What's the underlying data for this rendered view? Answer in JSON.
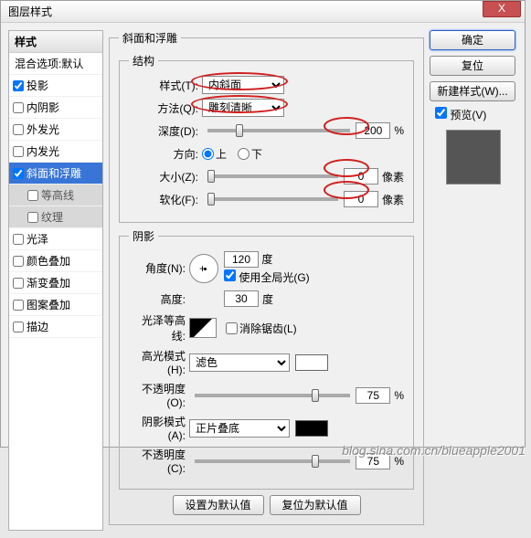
{
  "title": "图层样式",
  "close_x": "X",
  "sidebar": {
    "header": "样式",
    "blend": "混合选项:默认",
    "items": [
      {
        "label": "投影",
        "checked": true
      },
      {
        "label": "内阴影",
        "checked": false
      },
      {
        "label": "外发光",
        "checked": false
      },
      {
        "label": "内发光",
        "checked": false
      },
      {
        "label": "斜面和浮雕",
        "checked": true,
        "selected": true
      },
      {
        "label": "等高线",
        "checked": false,
        "sub": true
      },
      {
        "label": "纹理",
        "checked": false,
        "sub": true
      },
      {
        "label": "光泽",
        "checked": false
      },
      {
        "label": "颜色叠加",
        "checked": false
      },
      {
        "label": "渐变叠加",
        "checked": false
      },
      {
        "label": "图案叠加",
        "checked": false
      },
      {
        "label": "描边",
        "checked": false
      }
    ]
  },
  "panel": {
    "title": "斜面和浮雕",
    "structure": {
      "legend": "结构",
      "style_label": "样式(T):",
      "style_value": "内斜面",
      "technique_label": "方法(Q):",
      "technique_value": "雕刻清晰",
      "depth_label": "深度(D):",
      "depth_value": "200",
      "pct": "%",
      "direction_label": "方向:",
      "up": "上",
      "down": "下",
      "size_label": "大小(Z):",
      "size_value": "0",
      "px": "像素",
      "soften_label": "软化(F):",
      "soften_value": "0"
    },
    "shading": {
      "legend": "阴影",
      "angle_label": "角度(N):",
      "angle_value": "120",
      "deg": "度",
      "global_light": "使用全局光(G)",
      "altitude_label": "高度:",
      "altitude_value": "30",
      "contour_label": "光泽等高线:",
      "antialias": "消除锯齿(L)",
      "hilite_mode_label": "高光模式(H):",
      "hilite_mode_value": "滤色",
      "hilite_color": "#ffffff",
      "opacity_label": "不透明度(O):",
      "opacity_value": "75",
      "shadow_mode_label": "阴影模式(A):",
      "shadow_mode_value": "正片叠底",
      "shadow_color": "#000000",
      "opacity2_label": "不透明度(C):",
      "opacity2_value": "75"
    },
    "set_default": "设置为默认值",
    "reset_default": "复位为默认值"
  },
  "buttons": {
    "ok": "确定",
    "cancel": "复位",
    "new_style": "新建样式(W)...",
    "preview": "预览(V)"
  },
  "watermark": "blog.sina.com.cn/blueapple2001"
}
